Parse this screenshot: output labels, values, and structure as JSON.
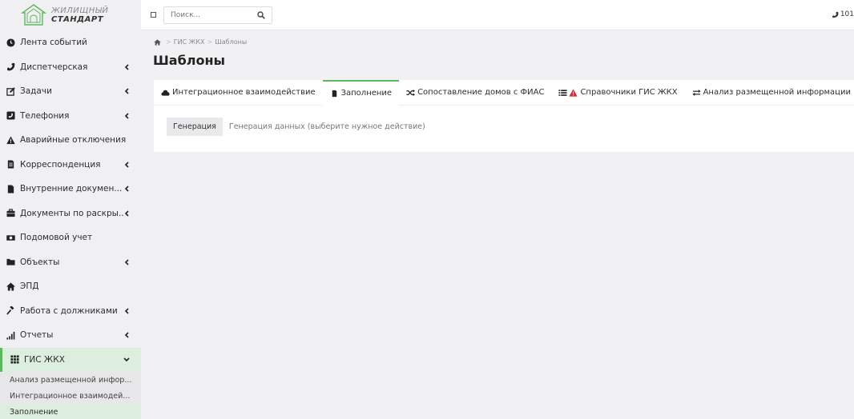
{
  "brand": {
    "line1": "ЖИЛИЩНЫЙ",
    "line2": "СТАНДАРТ",
    "accent_color": "#5cb85c"
  },
  "header": {
    "search_placeholder": "Поиск...",
    "phone_text": "101"
  },
  "sidebar": {
    "items": [
      {
        "label": "Лента событий",
        "icon": "clock-icon",
        "chevron": false
      },
      {
        "label": "Диспетчерская",
        "icon": "phone-icon",
        "chevron": true
      },
      {
        "label": "Задачи",
        "icon": "edit-icon",
        "chevron": true
      },
      {
        "label": "Телефония",
        "icon": "phone-square-icon",
        "chevron": true
      },
      {
        "label": "Аварийные отключения",
        "icon": "warning-icon",
        "chevron": false
      },
      {
        "label": "Корреспонденция",
        "icon": "document-icon",
        "chevron": true
      },
      {
        "label": "Внутренние докумен...",
        "icon": "file-icon",
        "chevron": true
      },
      {
        "label": "Документы по раскры...",
        "icon": "briefcase-icon",
        "chevron": true
      },
      {
        "label": "Подомовой учет",
        "icon": "money-icon",
        "chevron": false
      },
      {
        "label": "Объекты",
        "icon": "folder-icon",
        "chevron": true
      },
      {
        "label": "ЭПД",
        "icon": "home-icon",
        "chevron": false
      },
      {
        "label": "Работа с должниками",
        "icon": "gavel-icon",
        "chevron": true
      },
      {
        "label": "Отчеты",
        "icon": "signal-icon",
        "chevron": true
      },
      {
        "label": "ГИС ЖКХ",
        "icon": "grid-icon",
        "chevron": true
      }
    ],
    "sub_items": [
      {
        "label": "Анализ размещенной инфор..."
      },
      {
        "label": "Интеграционное взаимодей..."
      },
      {
        "label": "Заполнение"
      }
    ]
  },
  "breadcrumb": {
    "items": [
      "ГИС ЖКХ",
      "Шаблоны"
    ]
  },
  "page": {
    "title": "Шаблоны"
  },
  "tabs": [
    {
      "label": "Интеграционное взаимодействие",
      "icon": "cloud-icon"
    },
    {
      "label": "Заполнение",
      "icon": "file-icon"
    },
    {
      "label": "Сопоставление домов с ФИАС",
      "icon": "random-icon"
    },
    {
      "label": "Справочники ГИС ЖКХ",
      "icon": "list-warning-icon"
    },
    {
      "label": "Анализ размещенной информации",
      "icon": "exchange-icon"
    }
  ],
  "content": {
    "generate_button": "Генерация",
    "generate_desc": "Генерация данных (выберите нужное действие)"
  }
}
